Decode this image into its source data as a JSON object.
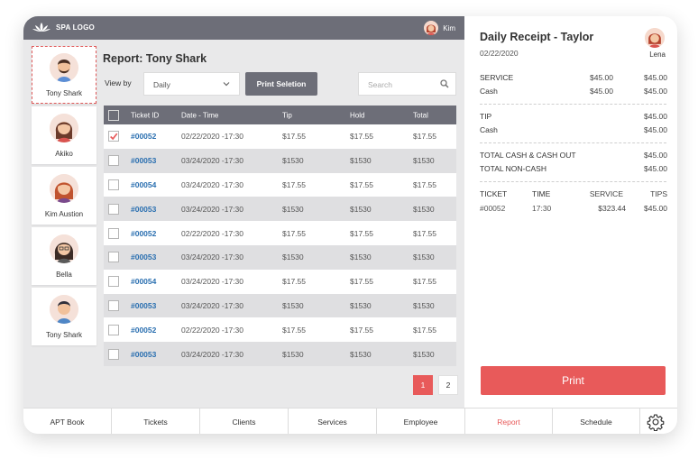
{
  "topbar": {
    "logo_text": "SPA LOGO",
    "user_name": "Kim"
  },
  "employees": [
    {
      "name": "Tony Shark",
      "active": true
    },
    {
      "name": "Akiko",
      "active": false
    },
    {
      "name": "Kim Austion",
      "active": false
    },
    {
      "name": "Bella",
      "active": false
    },
    {
      "name": "Tony Shark",
      "active": false
    }
  ],
  "report": {
    "title": "Report: Tony Shark",
    "view_by_label": "View by",
    "view_by_value": "Daily",
    "print_selection_label": "Print Seletion",
    "search_placeholder": "Search"
  },
  "table": {
    "columns": [
      "Ticket ID",
      "Date - Time",
      "Tip",
      "Hold",
      "Total"
    ],
    "rows": [
      {
        "id": "#00052",
        "datetime": "02/22/2020 -17:30",
        "tip": "$17.55",
        "hold": "$17.55",
        "total": "$17.55",
        "checked": true
      },
      {
        "id": "#00053",
        "datetime": "03/24/2020 -17:30",
        "tip": "$1530",
        "hold": "$1530",
        "total": "$1530",
        "checked": false
      },
      {
        "id": "#00054",
        "datetime": "03/24/2020 -17:30",
        "tip": "$17.55",
        "hold": "$17.55",
        "total": "$17.55",
        "checked": false
      },
      {
        "id": "#00053",
        "datetime": "03/24/2020 -17:30",
        "tip": "$1530",
        "hold": "$1530",
        "total": "$1530",
        "checked": false
      },
      {
        "id": "#00052",
        "datetime": "02/22/2020 -17:30",
        "tip": "$17.55",
        "hold": "$17.55",
        "total": "$17.55",
        "checked": false
      },
      {
        "id": "#00053",
        "datetime": "03/24/2020 -17:30",
        "tip": "$1530",
        "hold": "$1530",
        "total": "$1530",
        "checked": false
      },
      {
        "id": "#00054",
        "datetime": "03/24/2020 -17:30",
        "tip": "$17.55",
        "hold": "$17.55",
        "total": "$17.55",
        "checked": false
      },
      {
        "id": "#00053",
        "datetime": "03/24/2020 -17:30",
        "tip": "$1530",
        "hold": "$1530",
        "total": "$1530",
        "checked": false
      },
      {
        "id": "#00052",
        "datetime": "02/22/2020 -17:30",
        "tip": "$17.55",
        "hold": "$17.55",
        "total": "$17.55",
        "checked": false
      },
      {
        "id": "#00053",
        "datetime": "03/24/2020 -17:30",
        "tip": "$1530",
        "hold": "$1530",
        "total": "$1530",
        "checked": false
      }
    ]
  },
  "pagination": {
    "pages": [
      "1",
      "2"
    ],
    "current": "1"
  },
  "receipt": {
    "title": "Daily Receipt - Taylor",
    "date": "02/22/2020",
    "user_name": "Lena",
    "service_label": "SERVICE",
    "service_v1": "$45.00",
    "service_v2": "$45.00",
    "cash_label": "Cash",
    "cash_v1": "$45.00",
    "cash_v2": "$45.00",
    "tip_label": "TIP",
    "tip_value": "$45.00",
    "tip_cash_label": "Cash",
    "tip_cash_value": "$45.00",
    "total_cash_label": "TOTAL CASH & CASH OUT",
    "total_cash_value": "$45.00",
    "total_noncash_label": "TOTAL NON-CASH",
    "total_noncash_value": "$45.00",
    "detail_headers": [
      "TICKET",
      "TIME",
      "SERVICE",
      "TIPS"
    ],
    "detail_row": [
      "#00052",
      "17:30",
      "$323.44",
      "$45.00"
    ],
    "print_label": "Print"
  },
  "nav": {
    "items": [
      "APT Book",
      "Tickets",
      "Clients",
      "Services",
      "Employee",
      "Report",
      "Schedule"
    ],
    "active": "Report",
    "settings_icon": "gear-icon"
  },
  "colors": {
    "accent": "#e85a5a",
    "header": "#6d6e78",
    "link": "#2a6fb0"
  }
}
